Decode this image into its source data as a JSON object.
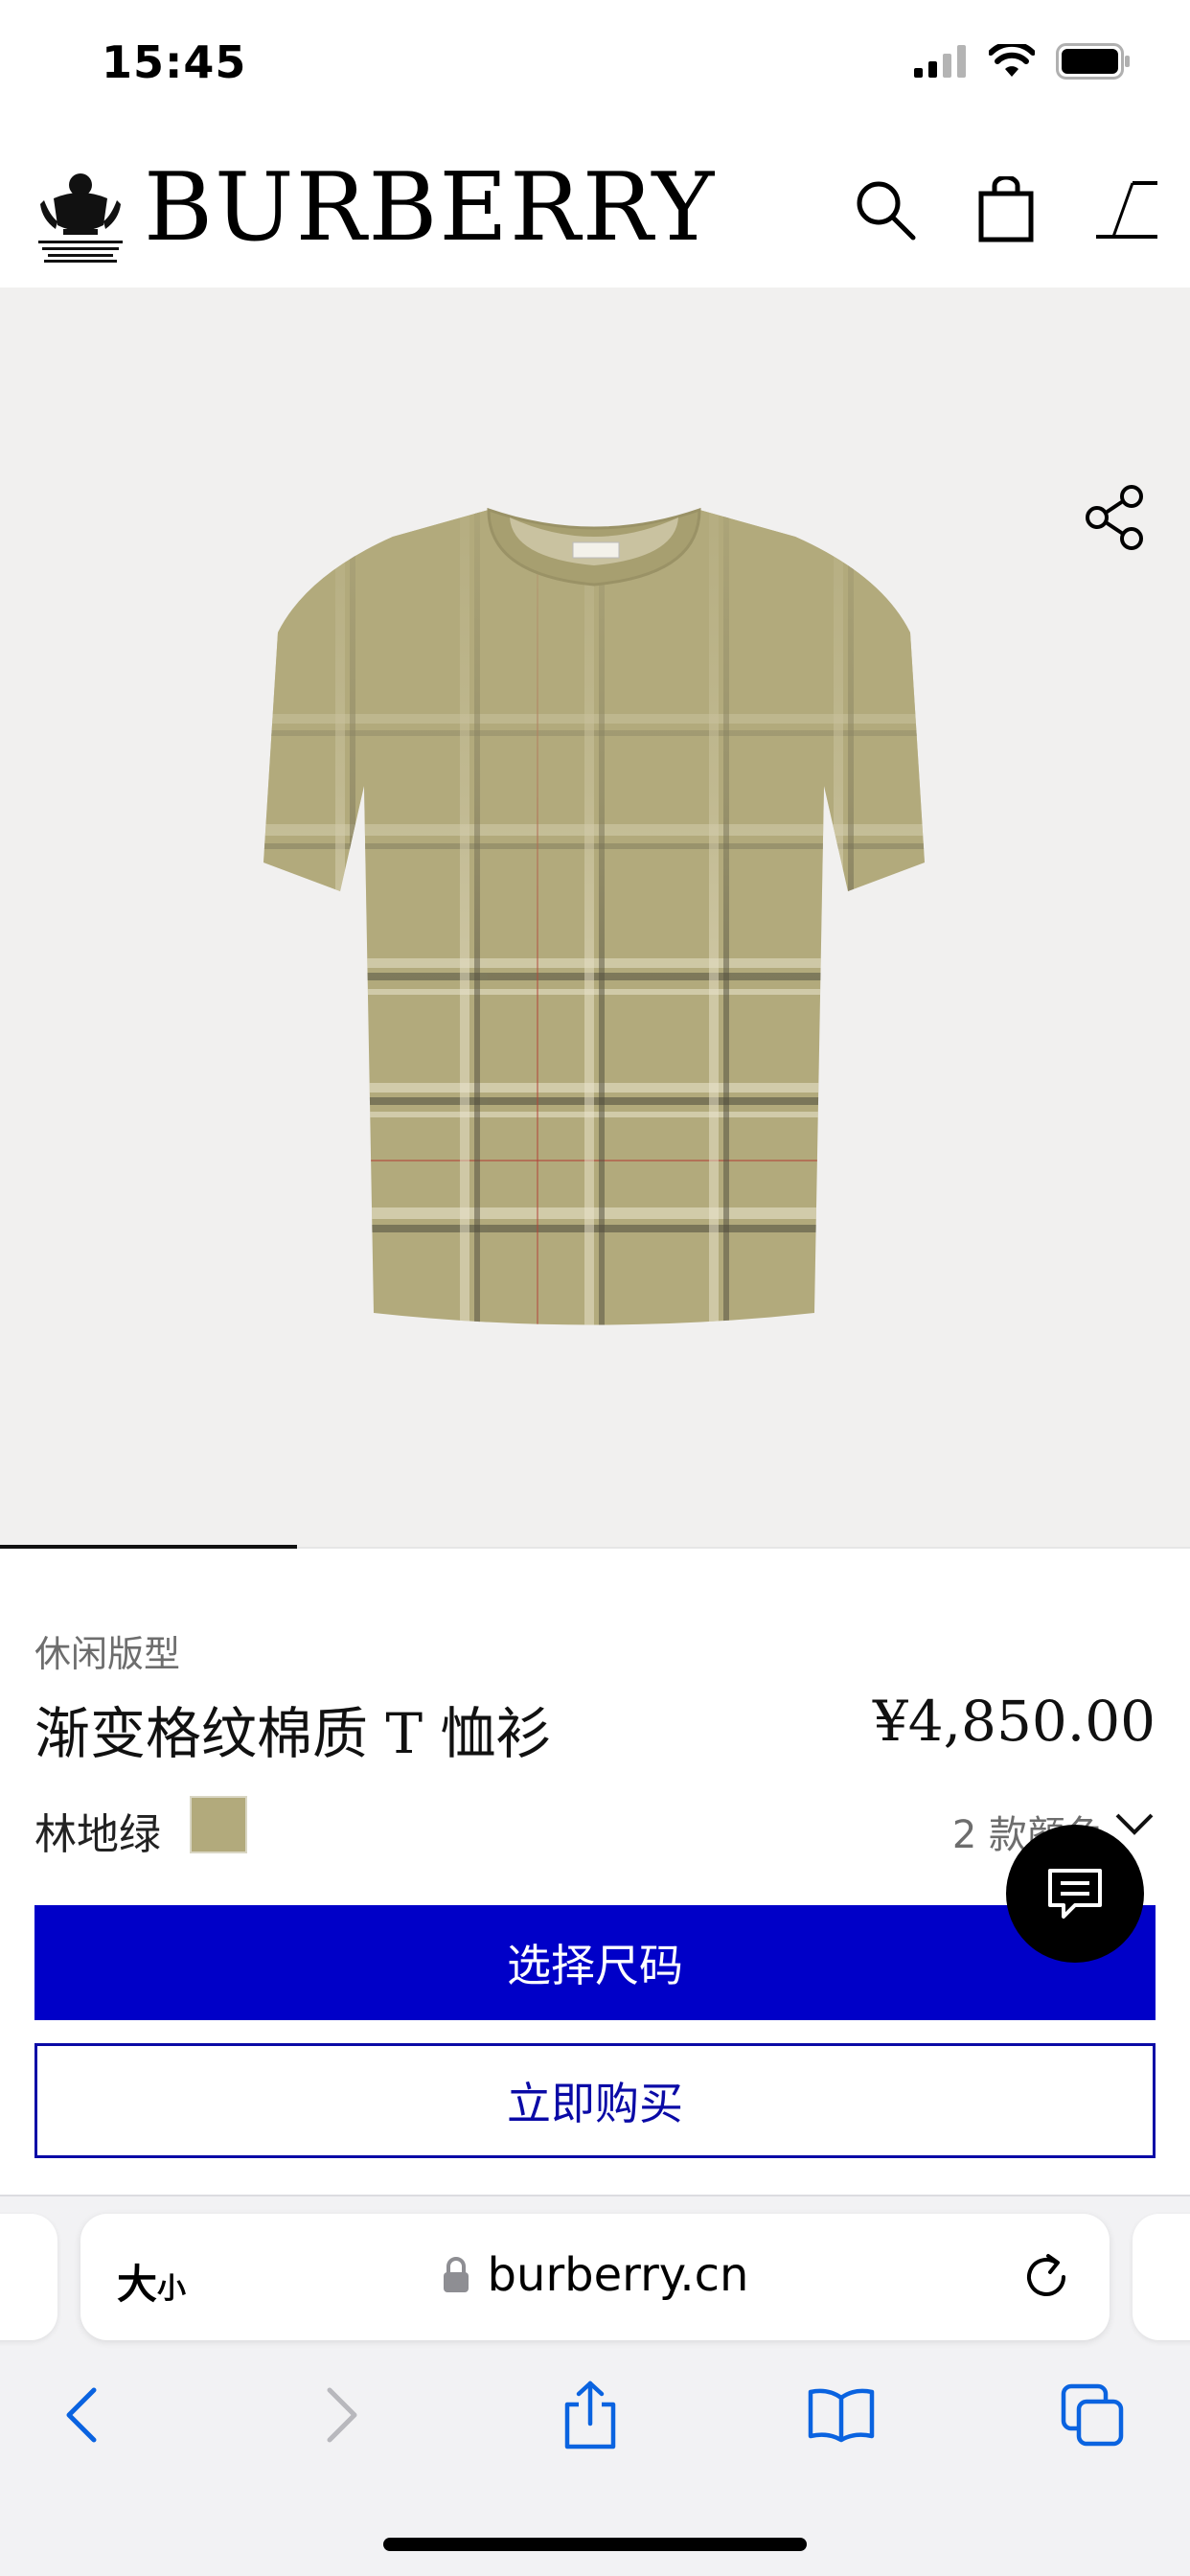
{
  "status_bar": {
    "time": "15:45"
  },
  "header": {
    "brand": "BURBERRY",
    "crest_text": "BY APPOINTMENT TO HIS MAJESTY KING CHARLES III OUTFITTERS BURBERRY LIMITED LONDON",
    "icons": [
      "search-icon",
      "shopping-bag-icon",
      "menu-icon"
    ]
  },
  "product": {
    "fit": "休闲版型",
    "title": "渐变格纹棉质 T 恤衫",
    "price": "¥4,850.00",
    "color_name": "林地绿",
    "color_swatch": "#b2aa7c",
    "color_count": "2 款颜色",
    "select_size_label": "选择尺码",
    "buy_now_label": "立即购买"
  },
  "browser": {
    "text_size_big": "大",
    "text_size_small": "小",
    "url": "burberry.cn"
  },
  "colors": {
    "primary_button": "#0000c8",
    "hero_background": "#f1f0ef",
    "shirt_base": "#b2aa7c"
  }
}
